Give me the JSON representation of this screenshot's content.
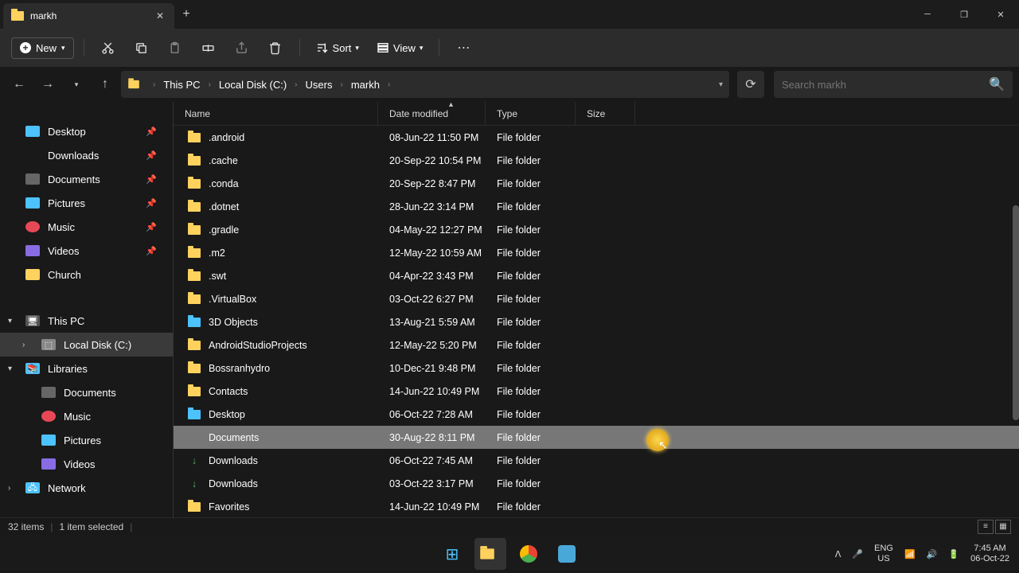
{
  "tab": {
    "title": "markh"
  },
  "toolbar": {
    "new": "New",
    "sort": "Sort",
    "view": "View"
  },
  "breadcrumbs": [
    "This PC",
    "Local Disk (C:)",
    "Users",
    "markh"
  ],
  "search": {
    "placeholder": "Search markh"
  },
  "sidebar": {
    "quick": [
      {
        "label": "Desktop",
        "icon": "desktop",
        "pin": true
      },
      {
        "label": "Downloads",
        "icon": "downloads",
        "pin": true
      },
      {
        "label": "Documents",
        "icon": "docs",
        "pin": true
      },
      {
        "label": "Pictures",
        "icon": "pics",
        "pin": true
      },
      {
        "label": "Music",
        "icon": "music",
        "pin": true
      },
      {
        "label": "Videos",
        "icon": "videos",
        "pin": true
      },
      {
        "label": "Church",
        "icon": "folder",
        "pin": false
      }
    ],
    "thispc": {
      "label": "This PC",
      "children": [
        {
          "label": "Local Disk (C:)"
        }
      ],
      "expanded": true,
      "selected_child": 0
    },
    "libraries": {
      "label": "Libraries",
      "children": [
        {
          "label": "Documents",
          "icon": "docs"
        },
        {
          "label": "Music",
          "icon": "music"
        },
        {
          "label": "Pictures",
          "icon": "pics"
        },
        {
          "label": "Videos",
          "icon": "videos"
        }
      ]
    },
    "network": {
      "label": "Network"
    }
  },
  "columns": {
    "name": "Name",
    "date": "Date modified",
    "type": "Type",
    "size": "Size"
  },
  "files": [
    {
      "name": ".android",
      "date": "08-Jun-22 11:50 PM",
      "type": "File folder",
      "icon": "folder"
    },
    {
      "name": ".cache",
      "date": "20-Sep-22 10:54 PM",
      "type": "File folder",
      "icon": "folder"
    },
    {
      "name": ".conda",
      "date": "20-Sep-22 8:47 PM",
      "type": "File folder",
      "icon": "folder"
    },
    {
      "name": ".dotnet",
      "date": "28-Jun-22 3:14 PM",
      "type": "File folder",
      "icon": "folder"
    },
    {
      "name": ".gradle",
      "date": "04-May-22 12:27 PM",
      "type": "File folder",
      "icon": "folder"
    },
    {
      "name": ".m2",
      "date": "12-May-22 10:59 AM",
      "type": "File folder",
      "icon": "folder"
    },
    {
      "name": ".swt",
      "date": "04-Apr-22 3:43 PM",
      "type": "File folder",
      "icon": "folder"
    },
    {
      "name": ".VirtualBox",
      "date": "03-Oct-22 6:27 PM",
      "type": "File folder",
      "icon": "folder"
    },
    {
      "name": "3D Objects",
      "date": "13-Aug-21 5:59 AM",
      "type": "File folder",
      "icon": "blue"
    },
    {
      "name": "AndroidStudioProjects",
      "date": "12-May-22 5:20 PM",
      "type": "File folder",
      "icon": "folder"
    },
    {
      "name": "Bossranhydro",
      "date": "10-Dec-21 9:48 PM",
      "type": "File folder",
      "icon": "folder"
    },
    {
      "name": "Contacts",
      "date": "14-Jun-22 10:49 PM",
      "type": "File folder",
      "icon": "folder"
    },
    {
      "name": "Desktop",
      "date": "06-Oct-22 7:28 AM",
      "type": "File folder",
      "icon": "blue"
    },
    {
      "name": "Documents",
      "date": "30-Aug-22 8:11 PM",
      "type": "File folder",
      "icon": "docs",
      "selected": true
    },
    {
      "name": "Downloads",
      "date": "06-Oct-22 7:45 AM",
      "type": "File folder",
      "icon": "dl"
    },
    {
      "name": "Downloads",
      "date": "03-Oct-22 3:17 PM",
      "type": "File folder",
      "icon": "dl"
    },
    {
      "name": "Favorites",
      "date": "14-Jun-22 10:49 PM",
      "type": "File folder",
      "icon": "folder"
    }
  ],
  "status": {
    "items": "32 items",
    "selected": "1 item selected"
  },
  "tray": {
    "lang1": "ENG",
    "lang2": "US",
    "time": "7:45 AM",
    "date": "06-Oct-22"
  }
}
